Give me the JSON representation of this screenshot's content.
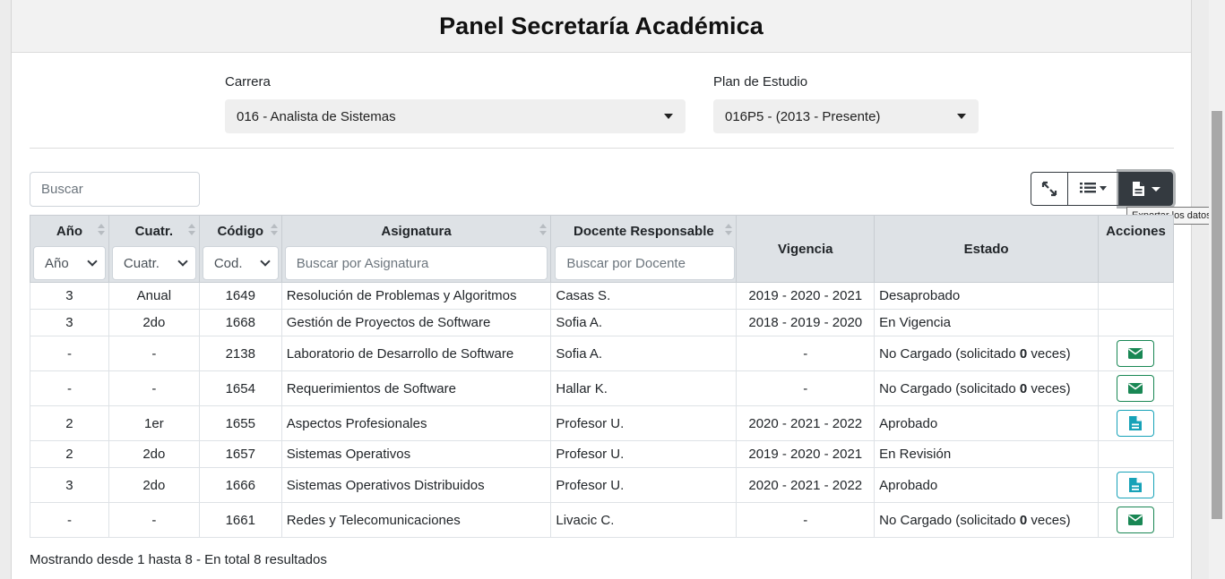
{
  "header": {
    "title": "Panel Secretaría Académica"
  },
  "filters": {
    "carrera_label": "Carrera",
    "carrera_value": "016 - Analista de Sistemas",
    "plan_label": "Plan de Estudio",
    "plan_value": "016P5 - (2013 - Presente)"
  },
  "search": {
    "placeholder": "Buscar"
  },
  "toolbar": {
    "fullscreen_icon": "expand-arrows-icon",
    "columns_icon": "list-icon",
    "export_icon": "file-export-icon",
    "export_tooltip": "Exportar los datos"
  },
  "table": {
    "headers": {
      "anio": "Año",
      "cuatr": "Cuatr.",
      "codigo": "Código",
      "asignatura": "Asignatura",
      "docente": "Docente Responsable",
      "vigencia": "Vigencia",
      "estado": "Estado",
      "acciones": "Acciones"
    },
    "column_filters": {
      "anio": "Año",
      "cuatr": "Cuatr.",
      "codigo": "Cod.",
      "asignatura_placeholder": "Buscar por Asignatura",
      "docente_placeholder": "Buscar por Docente"
    },
    "rows": [
      {
        "anio": "3",
        "cuatr": "Anual",
        "codigo": "1649",
        "asignatura": "Resolución de Problemas y Algoritmos",
        "docente": "Casas S.",
        "vigencia": "2019 - 2020 - 2021",
        "estado": "Desaprobado",
        "action": ""
      },
      {
        "anio": "3",
        "cuatr": "2do",
        "codigo": "1668",
        "asignatura": "Gestión de Proyectos de Software",
        "docente": "Sofia A.",
        "vigencia": "2018 - 2019 - 2020",
        "estado": "En Vigencia",
        "action": ""
      },
      {
        "anio": "-",
        "cuatr": "-",
        "codigo": "2138",
        "asignatura": "Laboratorio de Desarrollo de Software",
        "docente": "Sofia A.",
        "vigencia": "-",
        "estado_pre": "No Cargado (solicitado ",
        "estado_count": "0",
        "estado_post": " veces)",
        "action": "mail"
      },
      {
        "anio": "-",
        "cuatr": "-",
        "codigo": "1654",
        "asignatura": "Requerimientos de Software",
        "docente": "Hallar K.",
        "vigencia": "-",
        "estado_pre": "No Cargado (solicitado ",
        "estado_count": "0",
        "estado_post": " veces)",
        "action": "mail"
      },
      {
        "anio": "2",
        "cuatr": "1er",
        "codigo": "1655",
        "asignatura": "Aspectos Profesionales",
        "docente": "Profesor U.",
        "vigencia": "2020 - 2021 - 2022",
        "estado": "Aprobado",
        "action": "doc"
      },
      {
        "anio": "2",
        "cuatr": "2do",
        "codigo": "1657",
        "asignatura": "Sistemas Operativos",
        "docente": "Profesor U.",
        "vigencia": "2019 - 2020 - 2021",
        "estado": "En Revisión",
        "action": ""
      },
      {
        "anio": "3",
        "cuatr": "2do",
        "codigo": "1666",
        "asignatura": "Sistemas Operativos Distribuidos",
        "docente": "Profesor U.",
        "vigencia": "2020 - 2021 - 2022",
        "estado": "Aprobado",
        "action": "doc"
      },
      {
        "anio": "-",
        "cuatr": "-",
        "codigo": "1661",
        "asignatura": "Redes y Telecomunicaciones",
        "docente": "Livacic C.",
        "vigencia": "-",
        "estado_pre": "No Cargado (solicitado ",
        "estado_count": "0",
        "estado_post": " veces)",
        "action": "mail"
      }
    ]
  },
  "footer": {
    "summary": "Mostrando desde 1 hasta 8 - En total 8 resultados"
  },
  "colors": {
    "mail_green": "#198754",
    "doc_teal": "#17a2b8",
    "dark_button": "#343a40",
    "header_gray": "#dee2e6"
  }
}
